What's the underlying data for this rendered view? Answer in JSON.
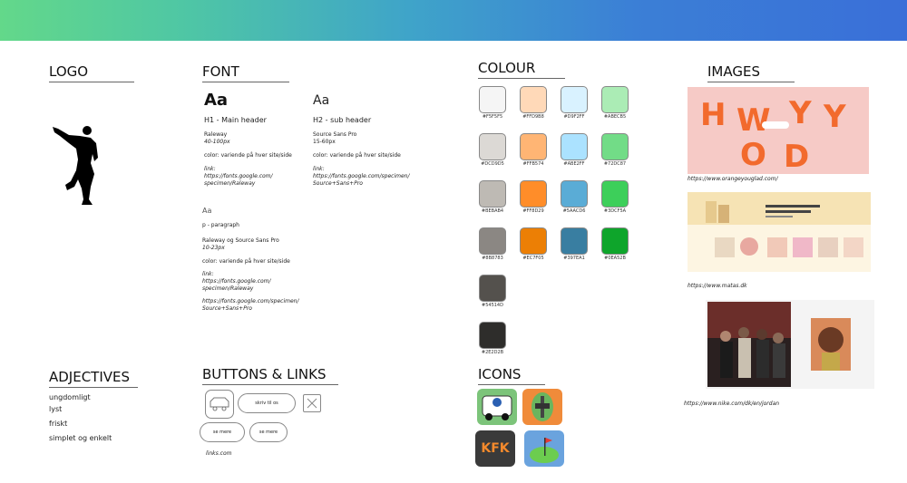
{
  "sections": {
    "logo": "LOGO",
    "font": "FONT",
    "colour": "COLOUR",
    "images": "IMAGES",
    "adjectives": "ADJECTIVES",
    "buttons": "BUTTONS & LINKS",
    "icons": "ICONS"
  },
  "font": {
    "h1": {
      "sample": "Aa",
      "title": "H1 - Main header",
      "family": "Raleway",
      "size": "40-100px",
      "color": "color: variende på hver site/side",
      "link_label": "link:",
      "link": [
        "https://fonts.google.com/",
        "specimen/Raleway"
      ]
    },
    "h2": {
      "sample": "Aa",
      "title": "H2 - sub header",
      "family": "Source Sans Pro",
      "size": "15-60px",
      "color": "color: variende på hver site/side",
      "link_label": "link:",
      "link": [
        "https://fonts.google.com/specimen/",
        "Source+Sans+Pro"
      ]
    },
    "p": {
      "sample": "Aa",
      "title": "p - paragraph",
      "family": "Raleway og Source Sans Pro",
      "size": "10-23px",
      "color": "color: variende på hver site/side",
      "link_label": "link:",
      "link1": [
        "https://fonts.google.com/",
        "specimen/Raleway"
      ],
      "link2": [
        "https://fonts.google.com/specimen/",
        "Source+Sans+Pro"
      ]
    }
  },
  "colours": [
    {
      "hex": "#F5F5F5",
      "label": "#F5F5F5"
    },
    {
      "hex": "#FFD9B8",
      "label": "#FFD9B8"
    },
    {
      "hex": "#D9F2FF",
      "label": "#D9F2FF"
    },
    {
      "hex": "#ABECB5",
      "label": "#ABECB5"
    },
    {
      "hex": "#DCD9D5",
      "label": "#DCD9D5"
    },
    {
      "hex": "#FFB574",
      "label": "#FFB574"
    },
    {
      "hex": "#ABE2FF",
      "label": "#ABE2FF"
    },
    {
      "hex": "#72DC87",
      "label": "#72DC87"
    },
    {
      "hex": "#BEBAB4",
      "label": "#BEBAB4"
    },
    {
      "hex": "#FF8D29",
      "label": "#FF8D29"
    },
    {
      "hex": "#5AACD6",
      "label": "#5AACD6"
    },
    {
      "hex": "#3DCF5A",
      "label": "#3DCF5A"
    },
    {
      "hex": "#8B8783",
      "label": "#8B8783"
    },
    {
      "hex": "#EC7F05",
      "label": "#EC7F05"
    },
    {
      "hex": "#397EA1",
      "label": "#397EA1"
    },
    {
      "hex": "#0EA52B",
      "label": "#0EA52B"
    },
    {
      "hex": "#54514D",
      "label": "#54514D"
    },
    {
      "hex": "#2E2D2B",
      "label": "#2E2D2B"
    }
  ],
  "images": [
    {
      "caption": "https://www.orangeyouglad.com/",
      "art": "HWYOD"
    },
    {
      "caption": "https://www.matas.dk"
    },
    {
      "caption": "https://www.nike.com/dk/en/jordan"
    }
  ],
  "adjectives": [
    "ungdomligt",
    "lyst",
    "friskt",
    "simplet og enkelt"
  ],
  "buttons": {
    "skriv": "skriv til os",
    "se1": "se mere",
    "se2": "se mere",
    "links": "links.com"
  },
  "icons": {
    "kfk": "KFK"
  }
}
